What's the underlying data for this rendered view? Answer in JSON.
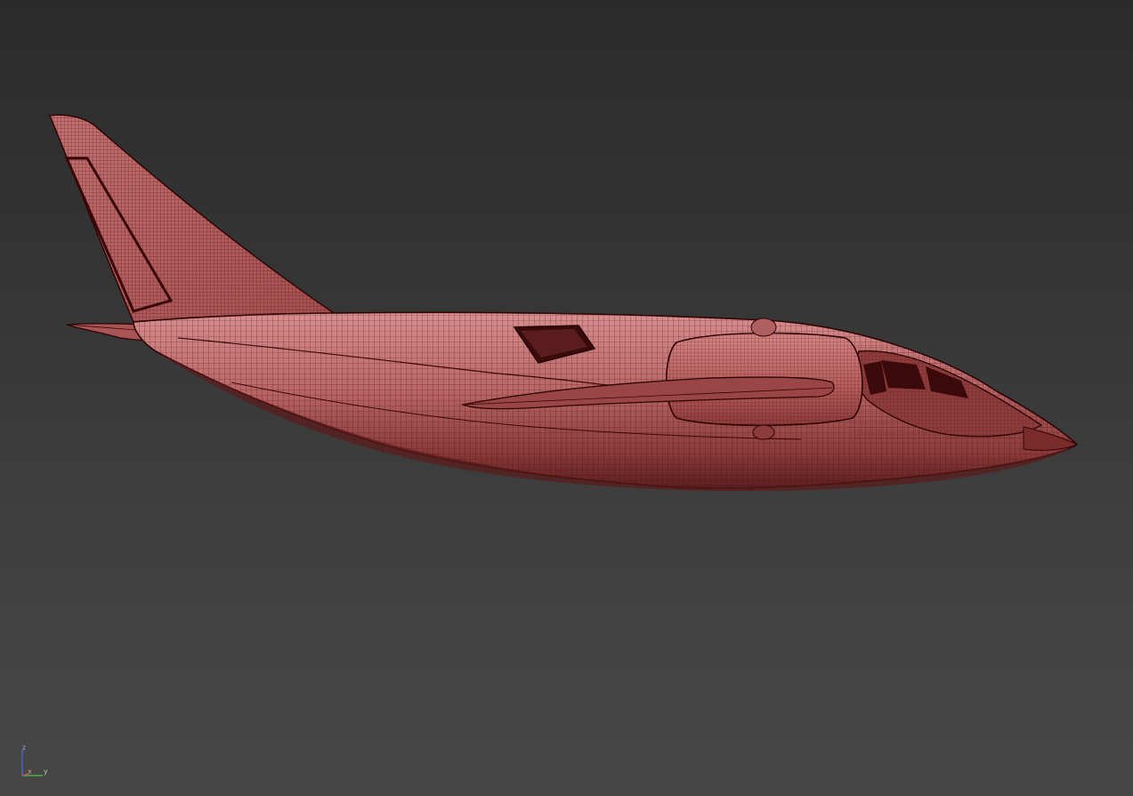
{
  "viewport": {
    "background_top": "#2b2b2b",
    "background_bottom": "#474747"
  },
  "model": {
    "wire_color": "#3a0606",
    "surface_color": "#b55a5a",
    "highlight_color": "#d98a8a"
  },
  "axis_gizmo": {
    "z_label": "z",
    "x_label": "x",
    "y_label": "y",
    "z_color": "#4a6fd8",
    "x_color": "#d84a4a",
    "y_color": "#4ac84a"
  }
}
